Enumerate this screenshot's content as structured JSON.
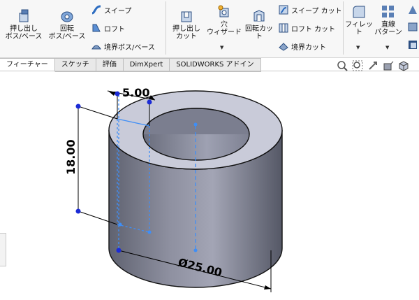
{
  "ribbon": {
    "extrude_boss": "押し出し\nボス/ベース",
    "revolve_boss": "回転\nボス/ベース",
    "sweep": "スイープ",
    "loft": "ロフト",
    "boundary_boss": "境界ボス/ベース",
    "extrude_cut": "押し出し\nカット",
    "hole_wizard": "穴\nウィザード",
    "revolve_cut": "回転カット",
    "sweep_cut": "スイープ カット",
    "loft_cut": "ロフト カット",
    "boundary_cut": "境界カット",
    "fillet": "フィレット",
    "linear_pattern": "直線\nパターン"
  },
  "tabs": [
    {
      "label": "フィーチャー",
      "active": true
    },
    {
      "label": "スケッチ",
      "active": false
    },
    {
      "label": "評価",
      "active": false
    },
    {
      "label": "DimXpert",
      "active": false
    },
    {
      "label": "SOLIDWORKS アドイン",
      "active": false
    }
  ],
  "model": {
    "dim_width": "5.00",
    "dim_height": "18.00",
    "dim_diameter": "Ø25.00"
  },
  "colors": {
    "accent": "#1f6fd6",
    "body_dark": "#6b6e7a",
    "body_light": "#a9abb8",
    "top_face": "#c9cbd9",
    "inner": "#8b8ea0",
    "sketch": "#3e8ef7",
    "point": "#1b2bd6"
  }
}
